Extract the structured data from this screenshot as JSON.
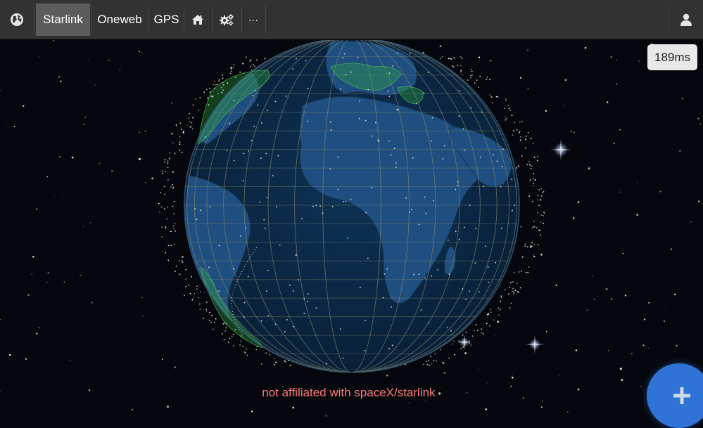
{
  "navbar": {
    "tabs": [
      {
        "label": "Starlink",
        "active": true
      },
      {
        "label": "Oneweb",
        "active": false
      },
      {
        "label": "GPS",
        "active": false
      }
    ],
    "more_label": "···",
    "icons": [
      "globe-icon",
      "home-icon",
      "settings-icon",
      "user-icon"
    ]
  },
  "status": {
    "latency": "189ms"
  },
  "footer": {
    "disclaimer": "not affiliated with spaceX/starlink"
  },
  "colors": {
    "navbar_bg": "#323232",
    "active_tab_bg": "#5c5c5c",
    "ocean": "#0b2a48",
    "land": "#1f4f80",
    "coverage": "#2fa83a",
    "disclaimer": "#ff7a7a",
    "fab": "#2f73d6"
  }
}
